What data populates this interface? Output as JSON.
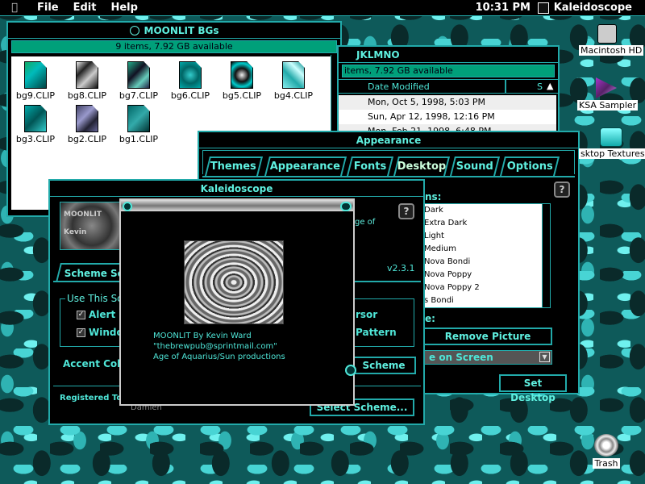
{
  "menubar": {
    "apple": "",
    "items": [
      "File",
      "Edit",
      "Help"
    ],
    "clock": "10:31 PM",
    "app_name": "Kaleidoscope"
  },
  "moonlit_window": {
    "title": "MOONLIT BGs",
    "status": "9 items, 7.92 GB available",
    "files": [
      "bg9.CLIP",
      "bg8.CLIP",
      "bg7.CLIP",
      "bg6.CLIP",
      "bg5.CLIP",
      "bg4.CLIP",
      "bg3.CLIP",
      "bg2.CLIP",
      "bg1.CLIP"
    ]
  },
  "jklmno_window": {
    "title": "JKLMNO",
    "status": "items, 7.92 GB available",
    "column_date": "Date Modified",
    "column_s": "S",
    "rows": [
      "Mon, Oct 5, 1998, 5:03 PM",
      "Sun, Apr 12, 1998, 12:16 PM",
      "Mon, Feb 21, 1998, 6:48 PM"
    ]
  },
  "appearance_window": {
    "title": "Appearance",
    "tabs": [
      "Themes",
      "Appearance",
      "Fonts",
      "Desktop",
      "Sound",
      "Options"
    ],
    "patterns_label": "ns:",
    "patterns": [
      "Dark",
      "Extra Dark",
      "Light",
      "Medium",
      "Nova Bondi",
      "Nova Poppy",
      "Nova Poppy 2",
      "s Bondi"
    ],
    "picture_label": "e:",
    "remove_picture": "Remove Picture",
    "position_value": "e on Screen",
    "set_desktop": "Set Desktop",
    "help": "?"
  },
  "kaleidoscope_window": {
    "title": "Kaleidoscope",
    "version": "v2.3.1",
    "tab_scheme": "Scheme Se",
    "use_this": "Use This Sc",
    "opt_alert": "Alert",
    "opt_window": "Windo",
    "opt_cursor": "rsor",
    "opt_pattern": "Pattern",
    "accent_color": "Accent Colo",
    "scheme_button": "Scheme",
    "registered": "Registered To",
    "registered_name": "Damien",
    "select_scheme": "Select Scheme...",
    "about_text": "ge of",
    "logo_text": "MOONLIT Kevin",
    "help": "?"
  },
  "about_box": {
    "line1": "MOONLIT By Kevin Ward",
    "line2": "\"thebrewpub@sprintmail.com\"",
    "line3": "Age of Aquarius/Sun productions"
  },
  "desktop_icons": {
    "hd": "Macintosh HD",
    "ksa": "KSA Sampler",
    "textures": "sktop Textures",
    "trash": "Trash"
  },
  "colors": {
    "accent": "#2aa",
    "text": "#4fe6d8",
    "status": "#00a07a"
  }
}
